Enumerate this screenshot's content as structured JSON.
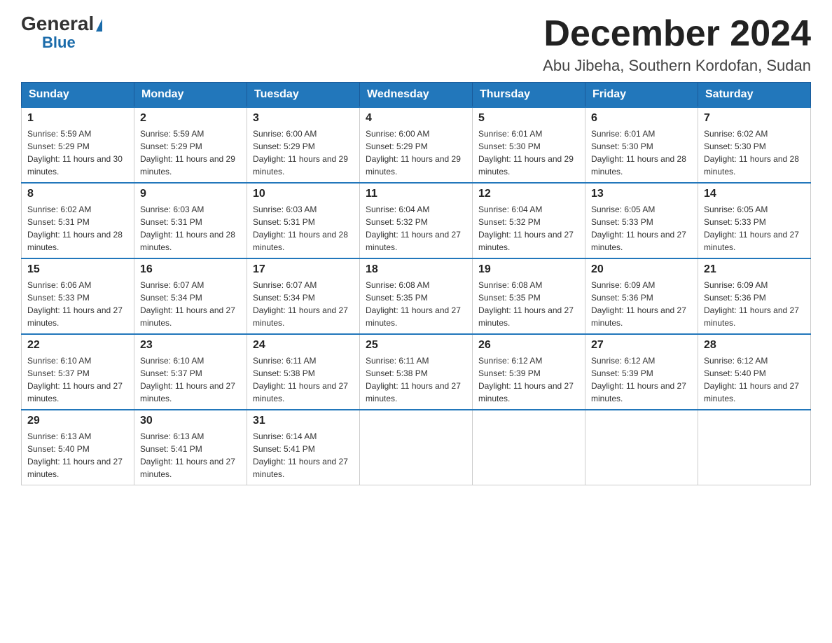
{
  "header": {
    "logo_general": "General",
    "logo_blue": "Blue",
    "month_title": "December 2024",
    "location": "Abu Jibeha, Southern Kordofan, Sudan"
  },
  "days_of_week": [
    "Sunday",
    "Monday",
    "Tuesday",
    "Wednesday",
    "Thursday",
    "Friday",
    "Saturday"
  ],
  "weeks": [
    [
      {
        "day": "1",
        "sunrise": "5:59 AM",
        "sunset": "5:29 PM",
        "daylight": "11 hours and 30 minutes."
      },
      {
        "day": "2",
        "sunrise": "5:59 AM",
        "sunset": "5:29 PM",
        "daylight": "11 hours and 29 minutes."
      },
      {
        "day": "3",
        "sunrise": "6:00 AM",
        "sunset": "5:29 PM",
        "daylight": "11 hours and 29 minutes."
      },
      {
        "day": "4",
        "sunrise": "6:00 AM",
        "sunset": "5:29 PM",
        "daylight": "11 hours and 29 minutes."
      },
      {
        "day": "5",
        "sunrise": "6:01 AM",
        "sunset": "5:30 PM",
        "daylight": "11 hours and 29 minutes."
      },
      {
        "day": "6",
        "sunrise": "6:01 AM",
        "sunset": "5:30 PM",
        "daylight": "11 hours and 28 minutes."
      },
      {
        "day": "7",
        "sunrise": "6:02 AM",
        "sunset": "5:30 PM",
        "daylight": "11 hours and 28 minutes."
      }
    ],
    [
      {
        "day": "8",
        "sunrise": "6:02 AM",
        "sunset": "5:31 PM",
        "daylight": "11 hours and 28 minutes."
      },
      {
        "day": "9",
        "sunrise": "6:03 AM",
        "sunset": "5:31 PM",
        "daylight": "11 hours and 28 minutes."
      },
      {
        "day": "10",
        "sunrise": "6:03 AM",
        "sunset": "5:31 PM",
        "daylight": "11 hours and 28 minutes."
      },
      {
        "day": "11",
        "sunrise": "6:04 AM",
        "sunset": "5:32 PM",
        "daylight": "11 hours and 27 minutes."
      },
      {
        "day": "12",
        "sunrise": "6:04 AM",
        "sunset": "5:32 PM",
        "daylight": "11 hours and 27 minutes."
      },
      {
        "day": "13",
        "sunrise": "6:05 AM",
        "sunset": "5:33 PM",
        "daylight": "11 hours and 27 minutes."
      },
      {
        "day": "14",
        "sunrise": "6:05 AM",
        "sunset": "5:33 PM",
        "daylight": "11 hours and 27 minutes."
      }
    ],
    [
      {
        "day": "15",
        "sunrise": "6:06 AM",
        "sunset": "5:33 PM",
        "daylight": "11 hours and 27 minutes."
      },
      {
        "day": "16",
        "sunrise": "6:07 AM",
        "sunset": "5:34 PM",
        "daylight": "11 hours and 27 minutes."
      },
      {
        "day": "17",
        "sunrise": "6:07 AM",
        "sunset": "5:34 PM",
        "daylight": "11 hours and 27 minutes."
      },
      {
        "day": "18",
        "sunrise": "6:08 AM",
        "sunset": "5:35 PM",
        "daylight": "11 hours and 27 minutes."
      },
      {
        "day": "19",
        "sunrise": "6:08 AM",
        "sunset": "5:35 PM",
        "daylight": "11 hours and 27 minutes."
      },
      {
        "day": "20",
        "sunrise": "6:09 AM",
        "sunset": "5:36 PM",
        "daylight": "11 hours and 27 minutes."
      },
      {
        "day": "21",
        "sunrise": "6:09 AM",
        "sunset": "5:36 PM",
        "daylight": "11 hours and 27 minutes."
      }
    ],
    [
      {
        "day": "22",
        "sunrise": "6:10 AM",
        "sunset": "5:37 PM",
        "daylight": "11 hours and 27 minutes."
      },
      {
        "day": "23",
        "sunrise": "6:10 AM",
        "sunset": "5:37 PM",
        "daylight": "11 hours and 27 minutes."
      },
      {
        "day": "24",
        "sunrise": "6:11 AM",
        "sunset": "5:38 PM",
        "daylight": "11 hours and 27 minutes."
      },
      {
        "day": "25",
        "sunrise": "6:11 AM",
        "sunset": "5:38 PM",
        "daylight": "11 hours and 27 minutes."
      },
      {
        "day": "26",
        "sunrise": "6:12 AM",
        "sunset": "5:39 PM",
        "daylight": "11 hours and 27 minutes."
      },
      {
        "day": "27",
        "sunrise": "6:12 AM",
        "sunset": "5:39 PM",
        "daylight": "11 hours and 27 minutes."
      },
      {
        "day": "28",
        "sunrise": "6:12 AM",
        "sunset": "5:40 PM",
        "daylight": "11 hours and 27 minutes."
      }
    ],
    [
      {
        "day": "29",
        "sunrise": "6:13 AM",
        "sunset": "5:40 PM",
        "daylight": "11 hours and 27 minutes."
      },
      {
        "day": "30",
        "sunrise": "6:13 AM",
        "sunset": "5:41 PM",
        "daylight": "11 hours and 27 minutes."
      },
      {
        "day": "31",
        "sunrise": "6:14 AM",
        "sunset": "5:41 PM",
        "daylight": "11 hours and 27 minutes."
      },
      null,
      null,
      null,
      null
    ]
  ],
  "labels": {
    "sunrise_prefix": "Sunrise: ",
    "sunset_prefix": "Sunset: ",
    "daylight_prefix": "Daylight: "
  }
}
